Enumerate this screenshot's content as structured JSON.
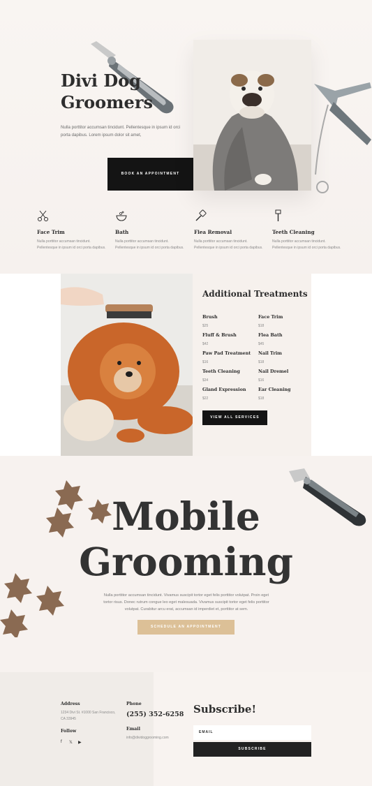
{
  "hero": {
    "title_line1": "Divi Dog",
    "title_line2": "Groomers",
    "description": "Nulla porttitor accumsan tincidunt. Pellentesque in ipsum id orci porta dapibus. Lorem ipsum dolor sit amet,",
    "button_label": "BOOK AN APPOINTMENT"
  },
  "services": [
    {
      "name": "Face Trim",
      "icon": "scissors-icon",
      "description": "Nulla porttitor accumsan tincidunt. Pellentesque in ipsum id orci porta dapibus."
    },
    {
      "name": "Bath",
      "icon": "bath-bowl-icon",
      "description": "Nulla porttitor accumsan tincidunt. Pellentesque in ipsum id orci porta dapibus."
    },
    {
      "name": "Flea Removal",
      "icon": "brush-icon",
      "description": "Nulla porttitor accumsan tincidunt. Pellentesque in ipsum id orci porta dapibus."
    },
    {
      "name": "Teeth Cleaning",
      "icon": "toothbrush-icon",
      "description": "Nulla porttitor accumsan tincidunt. Pellentesque in ipsum id orci porta dapibus."
    }
  ],
  "treatments": {
    "title": "Additional Treatments",
    "items": [
      {
        "name": "Brush",
        "price": "$25"
      },
      {
        "name": "Face Trim",
        "price": "$18"
      },
      {
        "name": "Fluff & Brush",
        "price": "$42"
      },
      {
        "name": "Flea Bath",
        "price": "$45"
      },
      {
        "name": "Paw Pad Treatment",
        "price": "$16"
      },
      {
        "name": "Nail Trim",
        "price": "$18"
      },
      {
        "name": "Teeth Cleaning",
        "price": "$34"
      },
      {
        "name": "Nail Dremel",
        "price": "$16"
      },
      {
        "name": "Gland Expression",
        "price": "$22"
      },
      {
        "name": "Ear Cleaning",
        "price": "$18"
      }
    ],
    "button_label": "VIEW ALL SERVICES"
  },
  "mobile": {
    "title_line1": "Mobile",
    "title_line2": "Grooming",
    "description": "Nulla porttitor accumsan tincidunt. Vivamus suscipit tortor eget felis porttitor volutpat. Proin eget tortor risus. Donec rutrum congue leo eget malesuada. Vivamus suscipit tortor eget felis porttitor volutpat. Curabitur arcu erat, accumsan id imperdiet et, porttitor at sem.",
    "button_label": "SCHEDULE AN APPOINTMENT"
  },
  "footer": {
    "address_label": "Address",
    "address_line1": "1234 Divi St. #1000 San Francisco,",
    "address_line2": "CA 33945",
    "follow_label": "Follow",
    "social_icons": [
      "facebook-icon",
      "twitter-icon",
      "youtube-icon"
    ],
    "phone_label": "Phone",
    "phone": "(255) 352-6258",
    "email_label": "Email",
    "email": "info@dividoggrooming.com",
    "subscribe_title": "Subscribe!",
    "email_placeholder": "EMAIL",
    "subscribe_button": "SUBSCRIBE"
  },
  "colors": {
    "accent_gold": "#dcc097",
    "dark": "#141414",
    "background": "#f8f4f1"
  }
}
